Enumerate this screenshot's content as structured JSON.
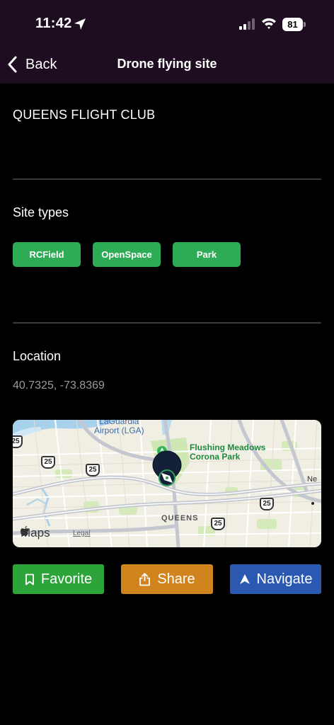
{
  "status_bar": {
    "time": "11:42",
    "battery": "81"
  },
  "nav": {
    "back_label": "Back",
    "title": "Drone flying site"
  },
  "site": {
    "name": "QUEENS FLIGHT CLUB"
  },
  "site_types": {
    "title": "Site types",
    "chips": [
      "RCField",
      "OpenSpace",
      "Park"
    ]
  },
  "location": {
    "title": "Location",
    "coordinates": "40.7325, -73.8369",
    "map": {
      "poi_label_line1": "Flushing Meadows",
      "poi_label_line2": "Corona Park",
      "airport_line1": "LaGuardia",
      "airport_line2": "Airport (LGA)",
      "district_label": "QUEENS",
      "edge_label": "Ne",
      "route_shield": "25",
      "maps_logo": "Maps",
      "legal": "Legal"
    }
  },
  "actions": {
    "favorite": "Favorite",
    "share": "Share",
    "navigate": "Navigate"
  },
  "colors": {
    "chip": "#2eab55",
    "favorite": "#2da43a",
    "share": "#d1831d",
    "navigate": "#2b58b0",
    "header": "#1e0d20"
  }
}
